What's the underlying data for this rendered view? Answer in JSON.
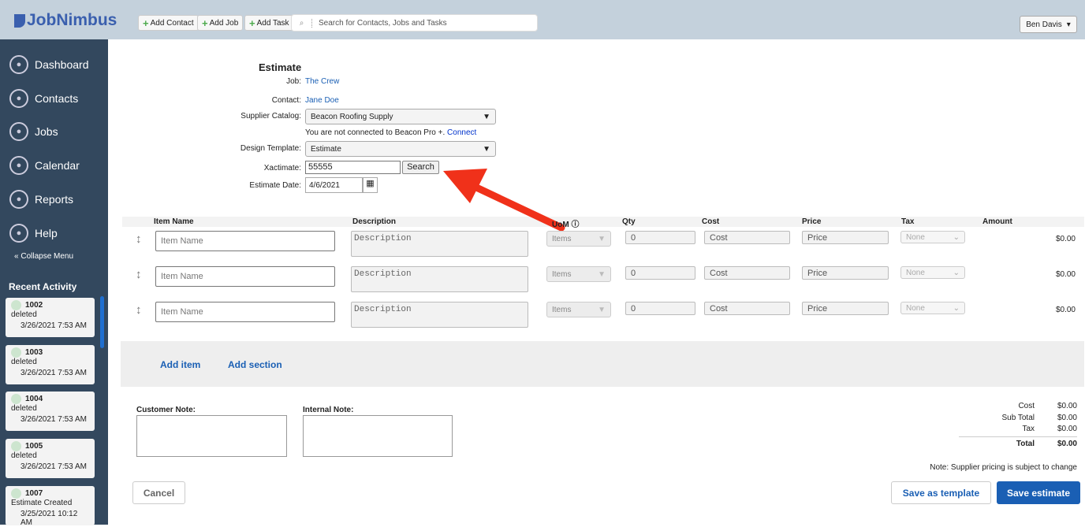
{
  "header": {
    "logo": "JobNimbus",
    "add_contact": "Add Contact",
    "add_job": "Add Job",
    "add_task": "Add Task",
    "search_placeholder": "Search for Contacts, Jobs and Tasks",
    "user": "Ben Davis"
  },
  "sidebar": {
    "items": [
      {
        "label": "Dashboard",
        "icon": "dashboard-icon"
      },
      {
        "label": "Contacts",
        "icon": "user-icon"
      },
      {
        "label": "Jobs",
        "icon": "tools-icon"
      },
      {
        "label": "Calendar",
        "icon": "calendar-icon"
      },
      {
        "label": "Reports",
        "icon": "chart-icon"
      },
      {
        "label": "Help",
        "icon": "lifebuoy-icon"
      }
    ],
    "collapse": "Collapse Menu",
    "recent_title": "Recent Activity",
    "recent": [
      {
        "id": "1002",
        "action": "deleted",
        "date": "3/26/2021 7:53 AM"
      },
      {
        "id": "1003",
        "action": "deleted",
        "date": "3/26/2021 7:53 AM"
      },
      {
        "id": "1004",
        "action": "deleted",
        "date": "3/26/2021 7:53 AM"
      },
      {
        "id": "1005",
        "action": "deleted",
        "date": "3/26/2021 7:53 AM"
      },
      {
        "id": "1007",
        "action": "Estimate Created",
        "date": "3/25/2021 10:12 AM"
      }
    ]
  },
  "form": {
    "title": "Estimate",
    "job_label": "Job:",
    "job": "The Crew",
    "contact_label": "Contact:",
    "contact": "Jane Doe",
    "supplier_label": "Supplier Catalog:",
    "supplier": "Beacon Roofing Supply",
    "not_connected": "You are not connected to Beacon Pro +.",
    "connect": "Connect",
    "template_label": "Design Template:",
    "template": "Estimate",
    "xactimate_label": "Xactimate:",
    "xactimate": "55555",
    "search": "Search",
    "date_label": "Estimate Date:",
    "date": "4/6/2021"
  },
  "table": {
    "headers": [
      "Item Name",
      "Description",
      "UoM",
      "Qty",
      "Cost",
      "Price",
      "Tax",
      "Amount"
    ],
    "rows": [
      {
        "item": "Item Name",
        "desc": "Description",
        "uom": "Items",
        "qty": "0",
        "cost": "Cost",
        "price": "Price",
        "tax": "None",
        "amount": "$0.00"
      },
      {
        "item": "Item Name",
        "desc": "Description",
        "uom": "Items",
        "qty": "0",
        "cost": "Cost",
        "price": "Price",
        "tax": "None",
        "amount": "$0.00"
      },
      {
        "item": "Item Name",
        "desc": "Description",
        "uom": "Items",
        "qty": "0",
        "cost": "Cost",
        "price": "Price",
        "tax": "None",
        "amount": "$0.00"
      }
    ],
    "add_item": "Add item",
    "add_section": "Add section"
  },
  "notes": {
    "customer": "Customer Note:",
    "internal": "Internal Note:"
  },
  "totals": [
    {
      "label": "Cost",
      "value": "$0.00"
    },
    {
      "label": "Sub Total",
      "value": "$0.00"
    },
    {
      "label": "Tax",
      "value": "$0.00"
    },
    {
      "label": "Total",
      "value": "$0.00"
    }
  ],
  "note": "Note: Supplier pricing is subject to change",
  "actions": {
    "cancel": "Cancel",
    "save_template": "Save as template",
    "save_estimate": "Save estimate"
  },
  "colors": {
    "accent": "#1a5fb4",
    "arrow": "#f0311a",
    "sidebar": "#33485e"
  }
}
